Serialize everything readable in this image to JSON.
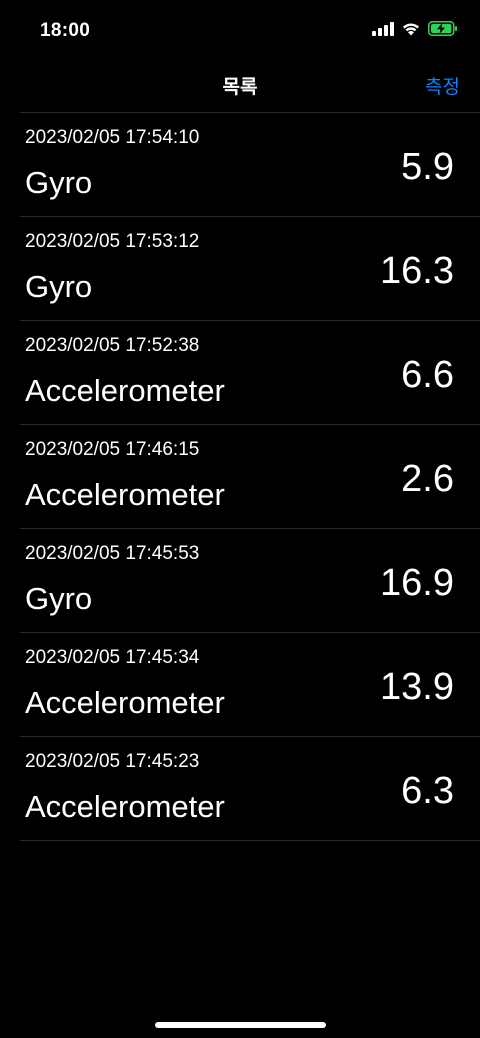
{
  "status_bar": {
    "time": "18:00",
    "icons": [
      "cellular-signal-icon",
      "wifi-icon",
      "battery-charging-icon"
    ]
  },
  "nav": {
    "title": "목록",
    "action_label": "측정"
  },
  "colors": {
    "background": "#000000",
    "accent": "#0a84ff",
    "battery_fill": "#30d158"
  },
  "measurements": [
    {
      "timestamp": "2023/02/05 17:54:10",
      "sensor": "Gyro",
      "value": "5.9"
    },
    {
      "timestamp": "2023/02/05 17:53:12",
      "sensor": "Gyro",
      "value": "16.3"
    },
    {
      "timestamp": "2023/02/05 17:52:38",
      "sensor": "Accelerometer",
      "value": "6.6"
    },
    {
      "timestamp": "2023/02/05 17:46:15",
      "sensor": "Accelerometer",
      "value": "2.6"
    },
    {
      "timestamp": "2023/02/05 17:45:53",
      "sensor": "Gyro",
      "value": "16.9"
    },
    {
      "timestamp": "2023/02/05 17:45:34",
      "sensor": "Accelerometer",
      "value": "13.9"
    },
    {
      "timestamp": "2023/02/05 17:45:23",
      "sensor": "Accelerometer",
      "value": "6.3"
    }
  ]
}
